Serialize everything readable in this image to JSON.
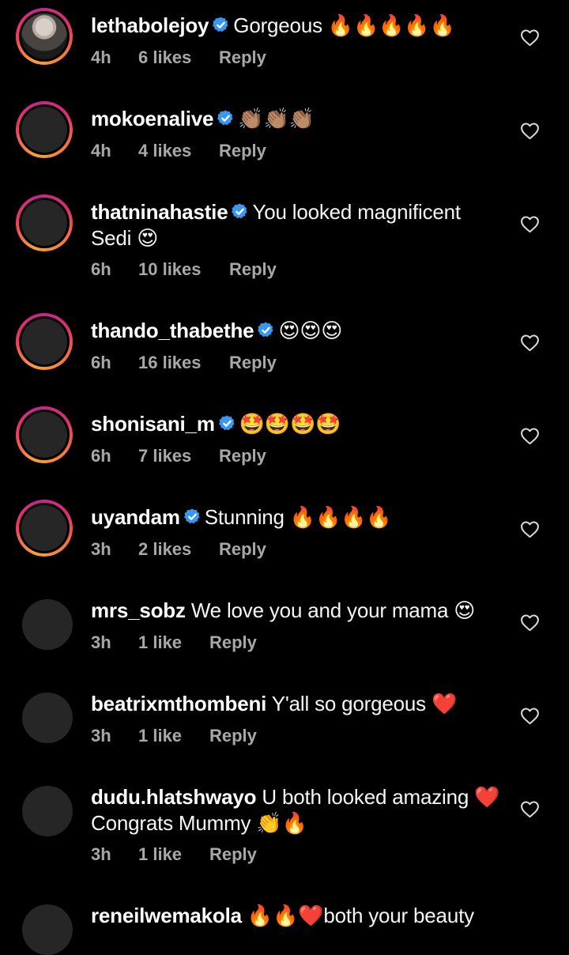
{
  "colors": {
    "background": "#000000",
    "text": "#f5f5f5",
    "meta": "#a8a8a8",
    "verified": "#3897f0",
    "ring_start": "#f9a13a",
    "ring_end": "#c4268d"
  },
  "comments": [
    {
      "username": "lethabolejoy",
      "verified": true,
      "text": "Gorgeous 🔥🔥🔥🔥🔥",
      "time": "4h",
      "likes": "6 likes",
      "reply": "Reply",
      "avatar": "story-ring-photo"
    },
    {
      "username": "mokoenalive",
      "verified": true,
      "text": "👏🏽👏🏽👏🏽",
      "time": "4h",
      "likes": "4 likes",
      "reply": "Reply",
      "avatar": "story-ring"
    },
    {
      "username": "thatninahastie",
      "verified": true,
      "text": "You looked magnificent Sedi 😍",
      "time": "6h",
      "likes": "10 likes",
      "reply": "Reply",
      "avatar": "story-ring"
    },
    {
      "username": "thando_thabethe",
      "verified": true,
      "text": "😍😍😍",
      "time": "6h",
      "likes": "16 likes",
      "reply": "Reply",
      "avatar": "story-ring"
    },
    {
      "username": "shonisani_m",
      "verified": true,
      "text": "🤩🤩🤩🤩",
      "time": "6h",
      "likes": "7 likes",
      "reply": "Reply",
      "avatar": "story-ring"
    },
    {
      "username": "uyandam",
      "verified": true,
      "text": "Stunning 🔥🔥🔥🔥",
      "time": "3h",
      "likes": "2 likes",
      "reply": "Reply",
      "avatar": "story-ring"
    },
    {
      "username": "mrs_sobz",
      "verified": false,
      "text": "We love you and your mama 😍",
      "time": "3h",
      "likes": "1 like",
      "reply": "Reply",
      "avatar": "plain"
    },
    {
      "username": "beatrixmthombeni",
      "verified": false,
      "text": "Y'all so gorgeous ❤️",
      "time": "3h",
      "likes": "1 like",
      "reply": "Reply",
      "avatar": "plain"
    },
    {
      "username": "dudu.hlatshwayo",
      "verified": false,
      "text": "U both looked amazing ❤️ Congrats Mummy 👏🔥",
      "time": "3h",
      "likes": "1 like",
      "reply": "Reply",
      "avatar": "plain"
    },
    {
      "username": "reneilwemakola",
      "verified": false,
      "text": "🔥🔥❤️both your beauty",
      "time": "",
      "likes": "",
      "reply": "",
      "avatar": "plain"
    }
  ],
  "icons": {
    "verified": "verified-badge-icon",
    "like": "heart-icon"
  }
}
